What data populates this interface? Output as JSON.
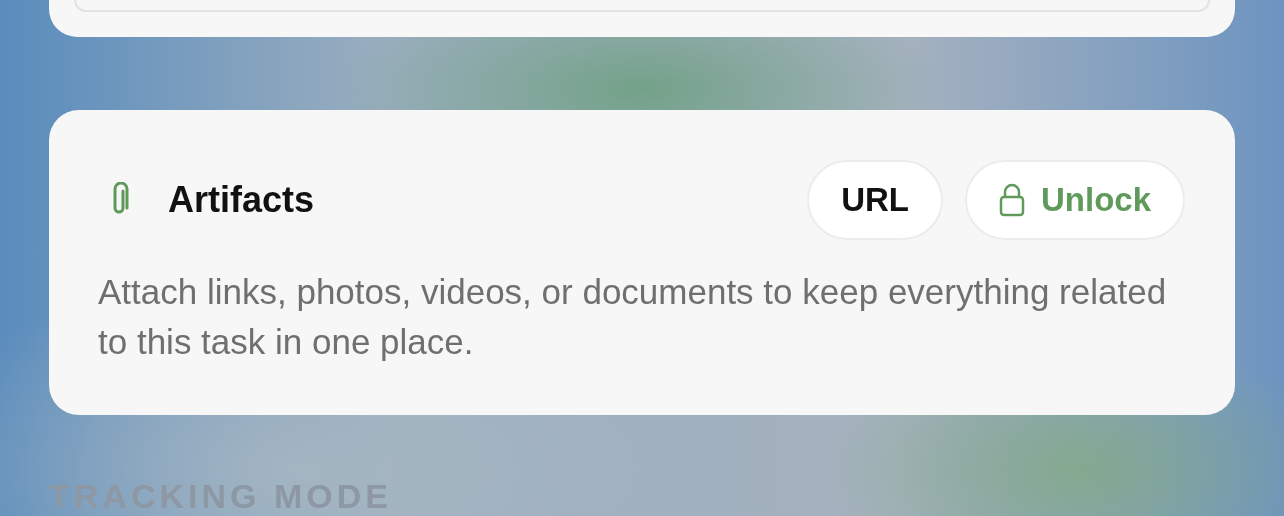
{
  "artifacts": {
    "title": "Artifacts",
    "buttons": [
      {
        "label": "URL",
        "kind": "plain"
      },
      {
        "label": "Unlock",
        "kind": "locked"
      }
    ],
    "description": "Attach links, photos, videos, or documents to keep everything related to this task in one place."
  },
  "section_label": "TRACKING MODE"
}
